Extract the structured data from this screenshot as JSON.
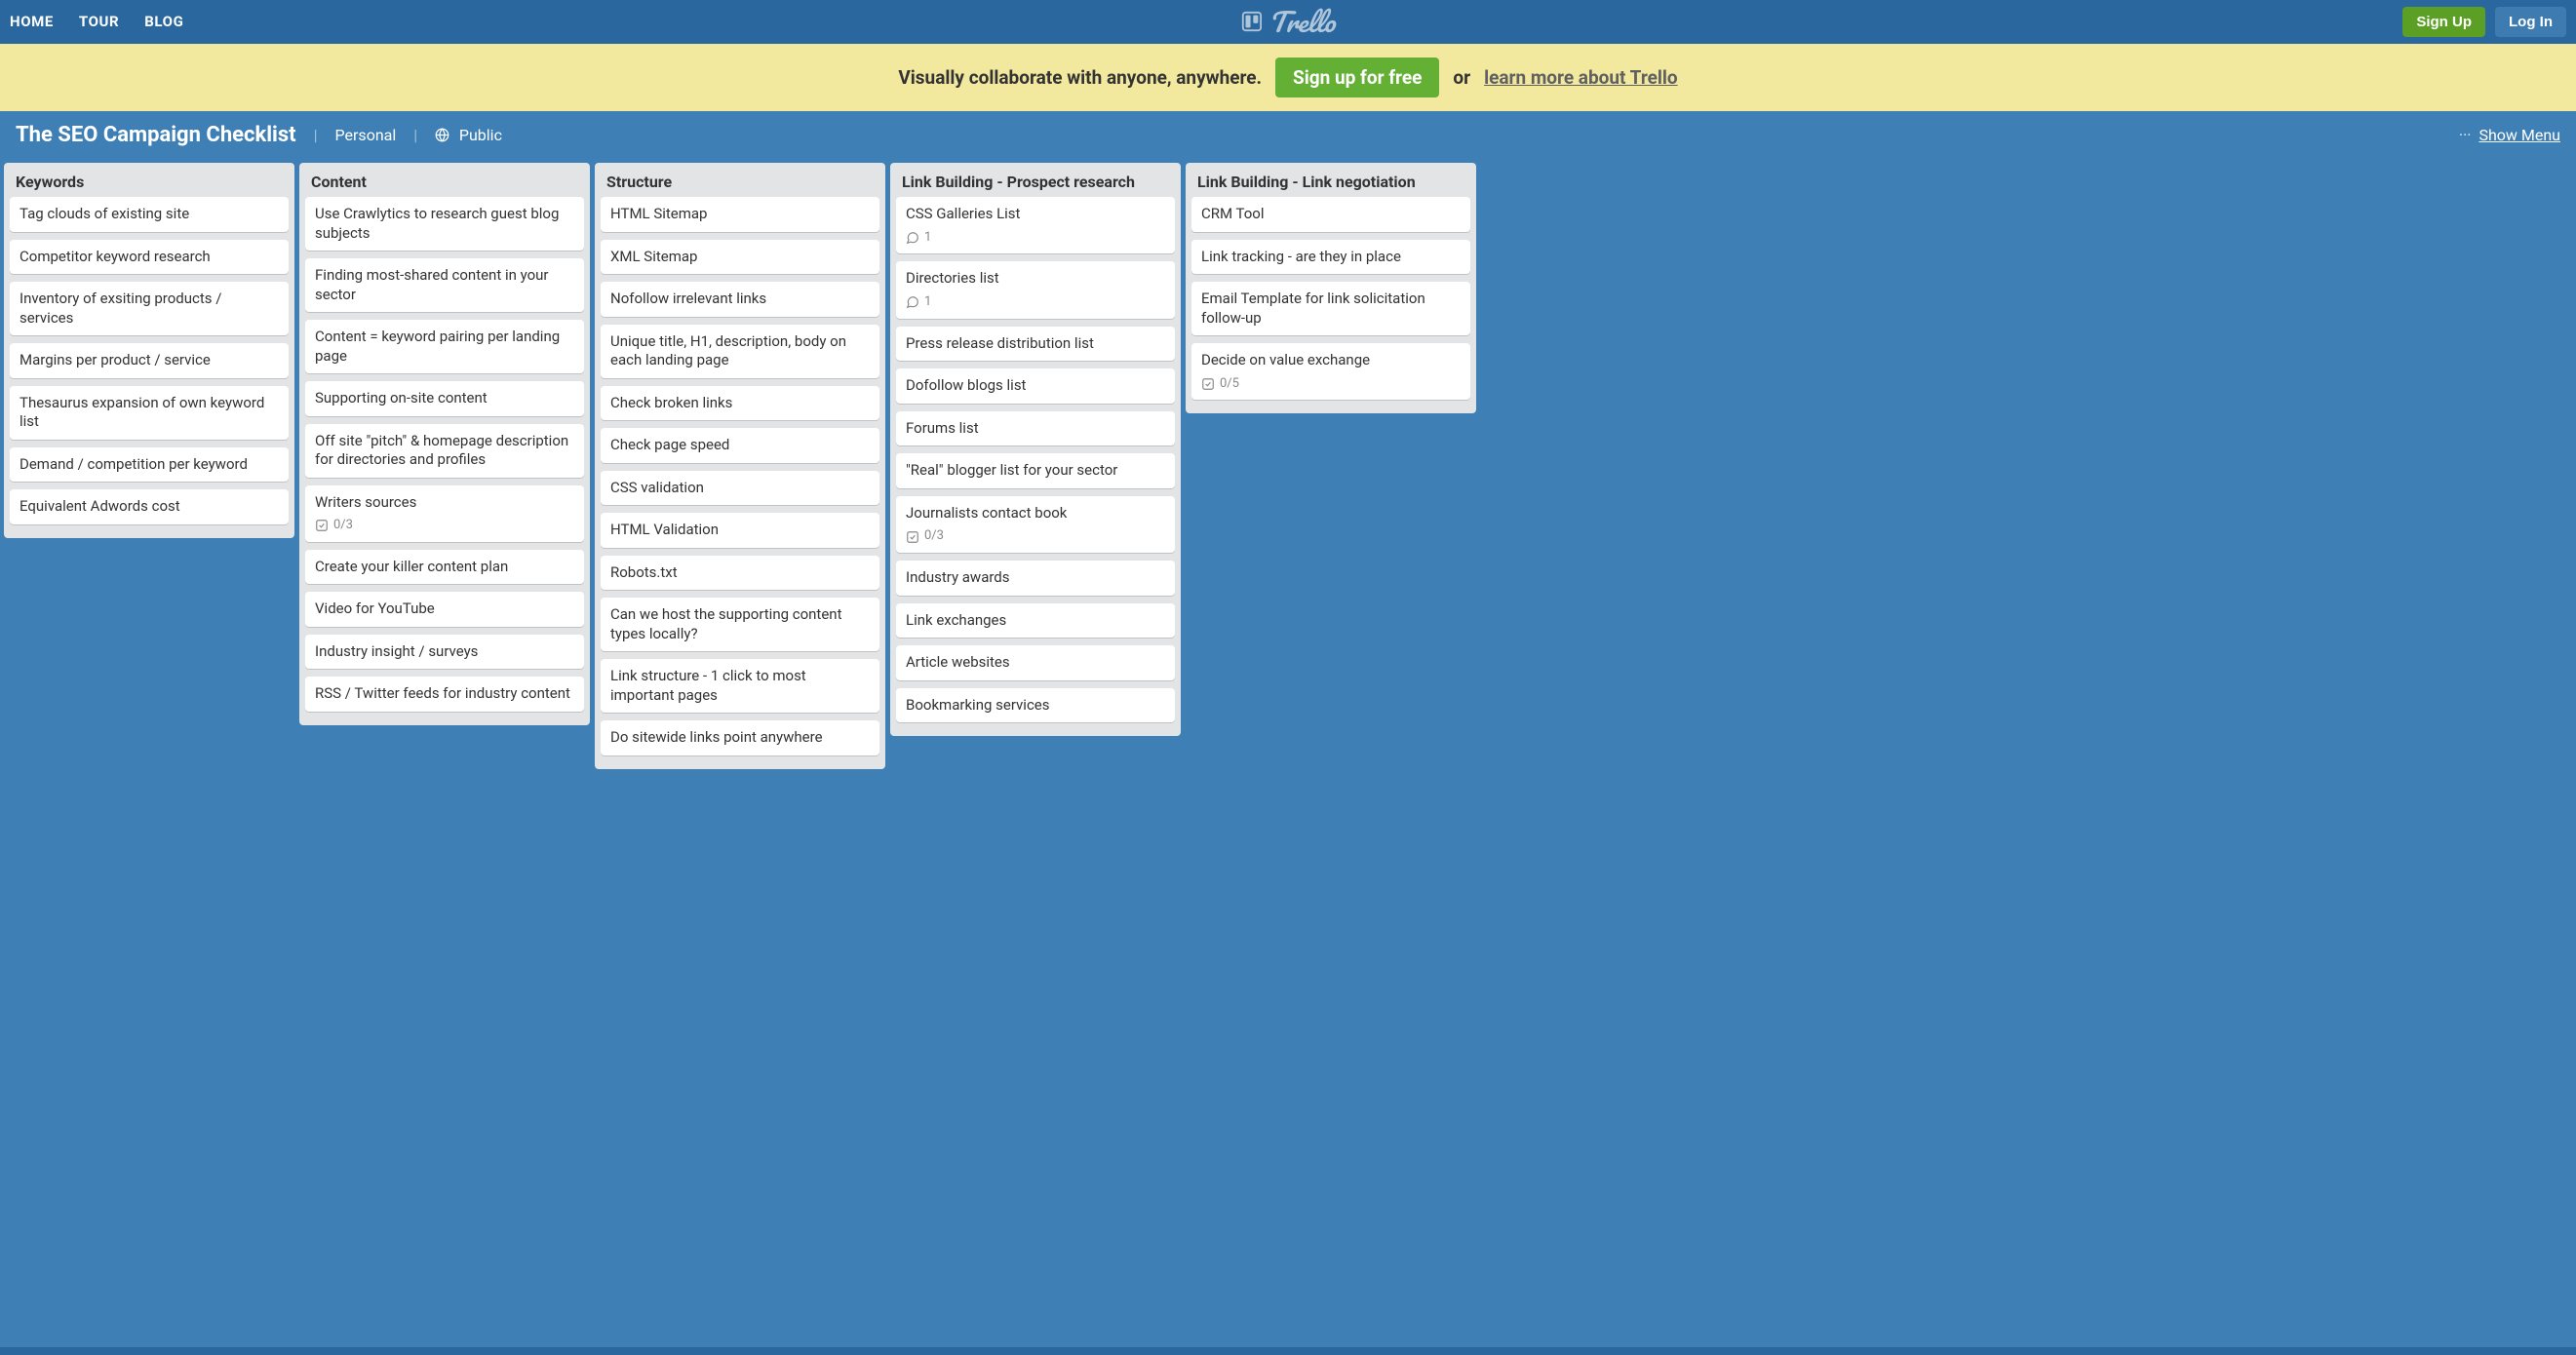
{
  "topnav": {
    "home": "HOME",
    "tour": "TOUR",
    "blog": "BLOG"
  },
  "brand": "Trello",
  "auth": {
    "signup": "Sign Up",
    "login": "Log In"
  },
  "promo": {
    "lead": "Visually collaborate with anyone, anywhere.",
    "signup": "Sign up for free",
    "or": "or",
    "learn": "learn more about Trello"
  },
  "board": {
    "title": "The SEO Campaign Checklist",
    "visibility_team": "Personal",
    "visibility_public": "Public",
    "menu_label": "Show Menu"
  },
  "lists": [
    {
      "title": "Keywords",
      "cards": [
        {
          "text": "Tag clouds of existing site"
        },
        {
          "text": "Competitor keyword research"
        },
        {
          "text": "Inventory of exsiting products / services"
        },
        {
          "text": "Margins per product / service"
        },
        {
          "text": "Thesaurus expansion of own keyword list"
        },
        {
          "text": "Demand / competition per keyword"
        },
        {
          "text": "Equivalent Adwords cost"
        }
      ]
    },
    {
      "title": "Content",
      "cards": [
        {
          "text": "Use Crawlytics to research guest blog subjects"
        },
        {
          "text": "Finding most-shared content in your sector"
        },
        {
          "text": "Content = keyword pairing per landing page"
        },
        {
          "text": "Supporting on-site content"
        },
        {
          "text": "Off site \"pitch\" & homepage description for directories and profiles"
        },
        {
          "text": "Writers sources",
          "checklist": "0/3"
        },
        {
          "text": "Create your killer content plan"
        },
        {
          "text": "Video for YouTube"
        },
        {
          "text": "Industry insight / surveys"
        },
        {
          "text": "RSS / Twitter feeds for industry content"
        }
      ]
    },
    {
      "title": "Structure",
      "cards": [
        {
          "text": "HTML Sitemap"
        },
        {
          "text": "XML Sitemap"
        },
        {
          "text": "Nofollow irrelevant links"
        },
        {
          "text": "Unique title, H1, description, body on each landing page"
        },
        {
          "text": "Check broken links"
        },
        {
          "text": "Check page speed"
        },
        {
          "text": "CSS validation"
        },
        {
          "text": "HTML Validation"
        },
        {
          "text": "Robots.txt"
        },
        {
          "text": "Can we host the supporting content types locally?"
        },
        {
          "text": "Link structure - 1 click to most important pages"
        },
        {
          "text": "Do sitewide links point anywhere"
        }
      ]
    },
    {
      "title": "Link Building - Prospect research",
      "cards": [
        {
          "text": "CSS Galleries List",
          "comments": "1"
        },
        {
          "text": "Directories list",
          "comments": "1"
        },
        {
          "text": "Press release distribution list"
        },
        {
          "text": "Dofollow blogs list"
        },
        {
          "text": "Forums list"
        },
        {
          "text": "\"Real\" blogger list for your sector"
        },
        {
          "text": "Journalists contact book",
          "checklist": "0/3"
        },
        {
          "text": "Industry awards"
        },
        {
          "text": "Link exchanges"
        },
        {
          "text": "Article websites"
        },
        {
          "text": "Bookmarking services"
        }
      ]
    },
    {
      "title": "Link Building - Link negotiation",
      "cards": [
        {
          "text": "CRM Tool"
        },
        {
          "text": "Link tracking - are they in place"
        },
        {
          "text": "Email Template for link solicitation follow-up"
        },
        {
          "text": "Decide on value exchange",
          "checklist": "0/5"
        }
      ]
    }
  ]
}
